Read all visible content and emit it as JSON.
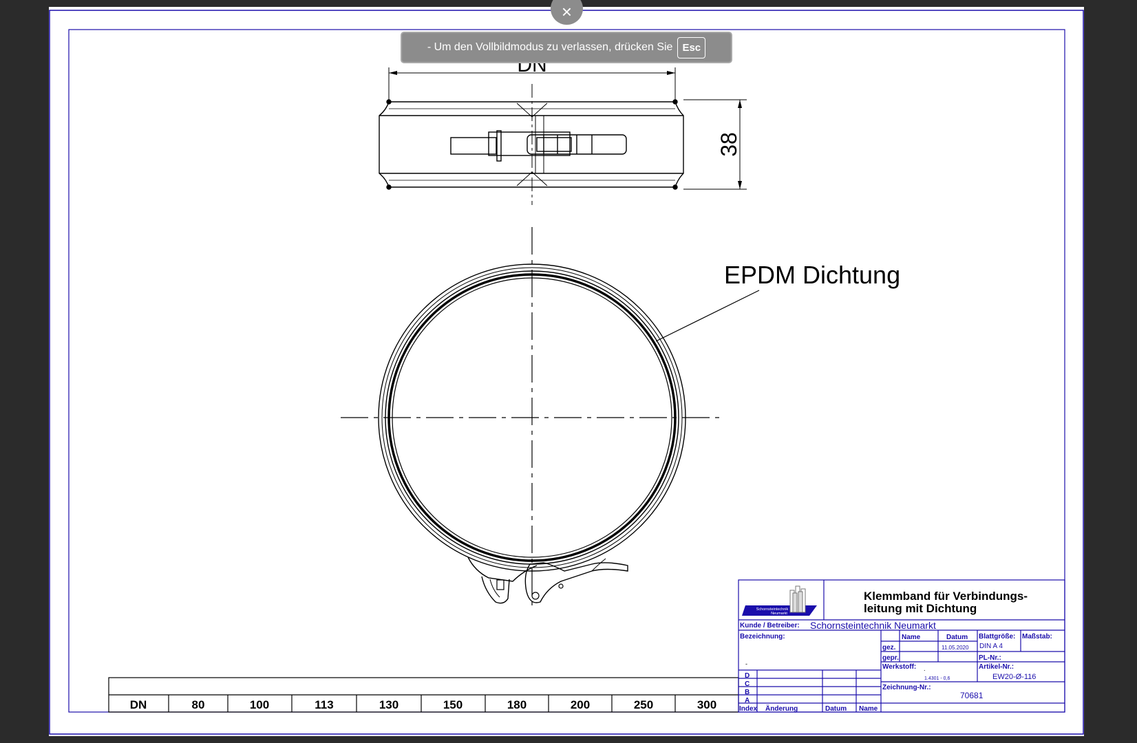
{
  "drawing": {
    "dim_dn": "DN",
    "dim_height": "38",
    "label_gasket": "EPDM Dichtung"
  },
  "dn_table": {
    "cells": [
      "DN",
      "80",
      "100",
      "113",
      "130",
      "150",
      "180",
      "200",
      "250",
      "300"
    ]
  },
  "title_block": {
    "logo_text_1": "Schornsteintechnik",
    "logo_text_2": "Neumarkt",
    "title_line_1": "Klemmband für Verbindungs-",
    "title_line_2": "leitung mit Dichtung",
    "kunde_label": "Kunde / Betreiber:",
    "kunde_value": "Schornsteintechnik Neumarkt",
    "bezeichnung_label": "Bezeichnung:",
    "dash": "-",
    "col_name": "Name",
    "col_datum": "Datum",
    "gez_label": "gez.",
    "gez_datum": "11.05.2020",
    "gepr_label": "gepr.",
    "blattgroesse_label": "Blattgröße:",
    "blattgroesse_value": "DIN A 4",
    "massstab_label": "Maßstab:",
    "pl_label": "PL-Nr.:",
    "werkstoff_label": "Werkstoff:",
    "werkstoff_dot": ".",
    "werkstoff_value": "1.4301 - 0,6",
    "artikel_label": "Artikel-Nr.:",
    "artikel_value": "EW20-Ø-116",
    "zeichnung_label": "Zeichnung-Nr.:",
    "zeichnung_value": "70681",
    "idx_d": "D",
    "idx_c": "C",
    "idx_b": "B",
    "idx_a": "A",
    "rev_index": "Index",
    "rev_aenderung": "Änderung",
    "rev_datum": "Datum",
    "rev_name": "Name"
  },
  "overlay": {
    "fullscreen_message": "-  Um den Vollbildmodus zu verlassen, drücken Sie",
    "esc_key": "Esc",
    "close_glyph": "×"
  },
  "colors": {
    "frame_blue": "#1a0dab",
    "line_black": "#000000",
    "banner_gray": "#8c8c8c"
  }
}
